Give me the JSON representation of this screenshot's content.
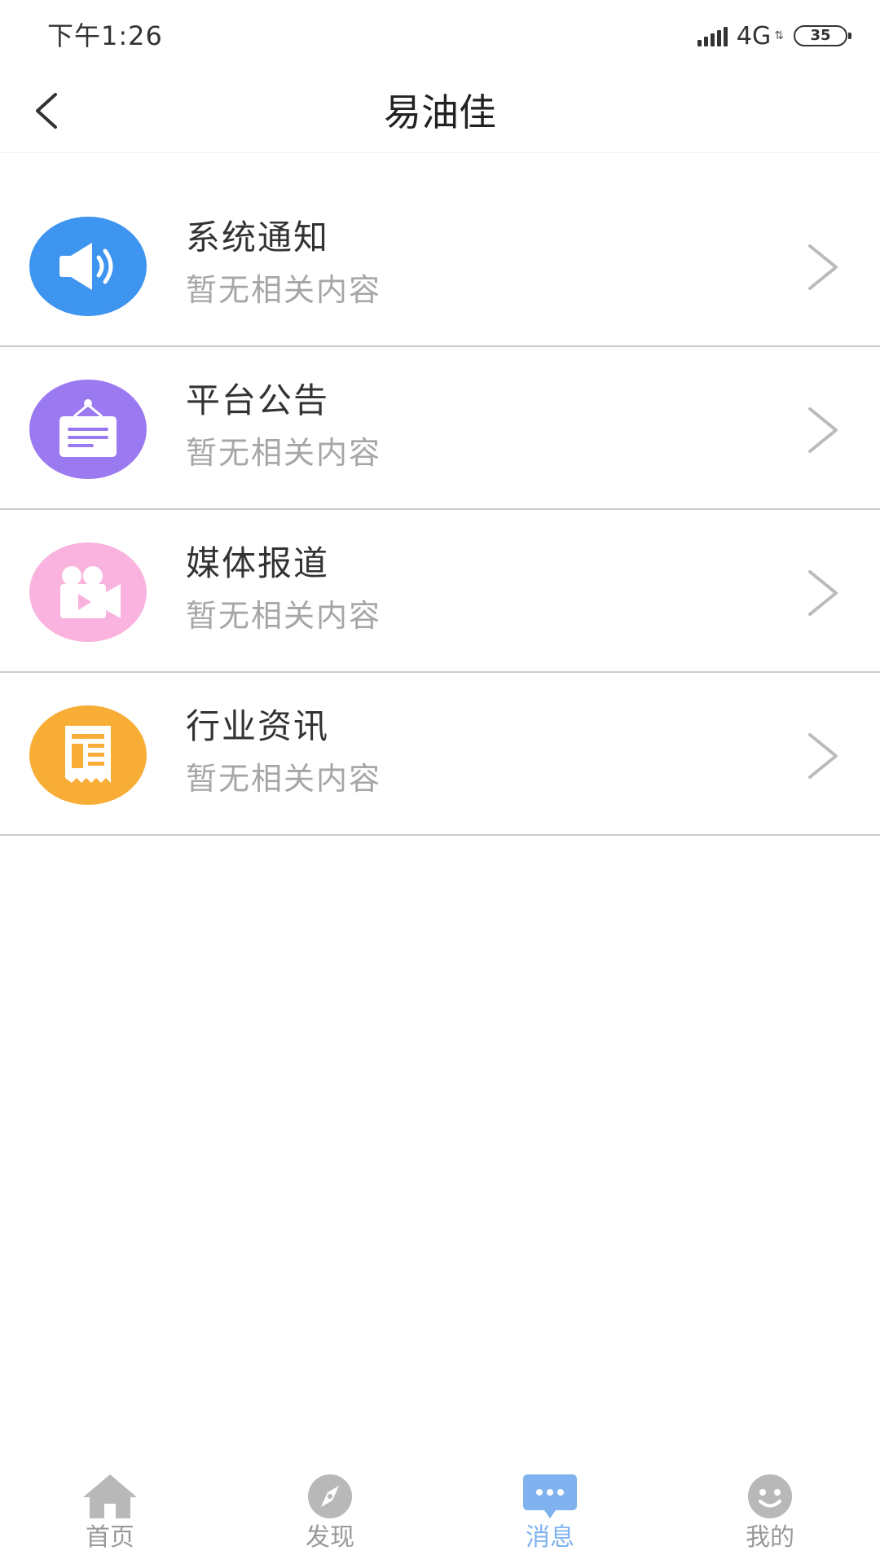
{
  "status_bar": {
    "time": "下午1:26",
    "network": "4G",
    "battery": "35"
  },
  "header": {
    "title": "易油佳"
  },
  "messages": [
    {
      "title": "系统通知",
      "subtitle": "暂无相关内容",
      "icon": "speaker-icon",
      "color": "#3d95f0"
    },
    {
      "title": "平台公告",
      "subtitle": "暂无相关内容",
      "icon": "notice-board-icon",
      "color": "#9b79f0"
    },
    {
      "title": "媒体报道",
      "subtitle": "暂无相关内容",
      "icon": "video-camera-icon",
      "color": "#f9b3de"
    },
    {
      "title": "行业资讯",
      "subtitle": "暂无相关内容",
      "icon": "newspaper-icon",
      "color": "#f8ae36"
    }
  ],
  "tabs": [
    {
      "label": "首页",
      "icon": "home-icon",
      "active": false
    },
    {
      "label": "发现",
      "icon": "compass-icon",
      "active": false
    },
    {
      "label": "消息",
      "icon": "message-icon",
      "active": true
    },
    {
      "label": "我的",
      "icon": "smiley-icon",
      "active": false
    }
  ],
  "colors": {
    "active_tab": "#7fb2ee",
    "inactive_tab": "#999999",
    "subtitle": "#a6a6a6"
  }
}
